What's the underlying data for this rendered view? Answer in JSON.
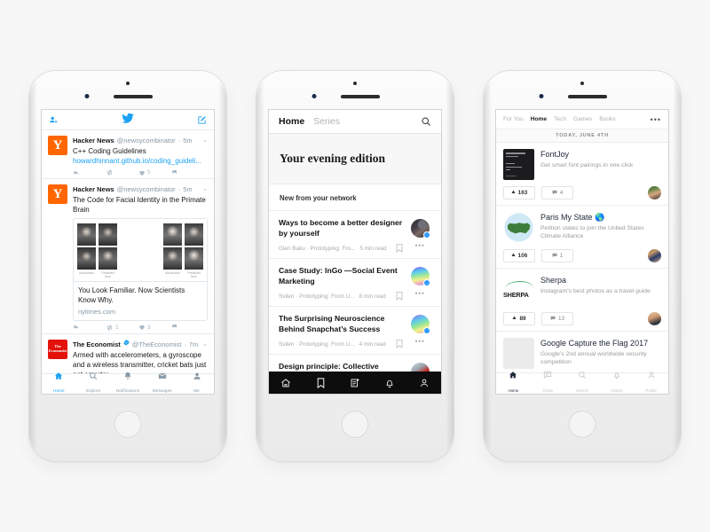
{
  "canvas": {
    "background": "#f7f7f7"
  },
  "phone1": {
    "app": "Twitter",
    "header": {
      "add_person_icon": "add-person-icon",
      "logo_icon": "twitter-bird-icon",
      "compose_icon": "compose-icon"
    },
    "tweets": [
      {
        "avatar_letter": "Y",
        "avatar_color": "#ff6600",
        "name": "Hacker News",
        "handle": "@newsycombinator",
        "time": "5m",
        "verified": false,
        "text": "C++ Coding Guidelines",
        "link": "howardhinnant.github.io/coding_guideli...",
        "replies": "",
        "retweets": "",
        "likes": "5",
        "card": null
      },
      {
        "avatar_letter": "Y",
        "avatar_color": "#ff6600",
        "name": "Hacker News",
        "handle": "@newsycombinator",
        "time": "5m",
        "verified": false,
        "text": "The Code for Facial Identity in the Primate Brain",
        "link": "",
        "replies": "",
        "retweets": "1",
        "likes": "3",
        "card": {
          "title": "You Look Familiar. Now Scientists Know Why.",
          "domain": "nytimes.com",
          "captions": [
            "Actual face",
            "Predicted face",
            "Actual face",
            "Predicted face"
          ]
        }
      },
      {
        "avatar_letter": "",
        "avatar_logo_text": "The Economist",
        "avatar_color": "#e3120b",
        "name": "The Economist",
        "handle": "@TheEconomist",
        "time": "7m",
        "verified": true,
        "text": "Armed with accelerometers, a gyroscope and a wireless transmitter, cricket bats just got smarter",
        "link": "",
        "card": null
      }
    ],
    "tabs": [
      {
        "label": "Home",
        "icon": "home-icon",
        "active": true
      },
      {
        "label": "Explore",
        "icon": "search-icon",
        "active": false
      },
      {
        "label": "Notifications",
        "icon": "bell-icon",
        "active": false
      },
      {
        "label": "Messages",
        "icon": "envelope-icon",
        "active": false
      },
      {
        "label": "Me",
        "icon": "person-icon",
        "active": false
      }
    ],
    "accent": "#1da1f2"
  },
  "phone2": {
    "app": "Medium",
    "header": {
      "tabs": [
        {
          "label": "Home",
          "active": true
        },
        {
          "label": "Series",
          "active": false
        }
      ],
      "search_icon": "search-icon"
    },
    "hero_title": "Your evening edition",
    "section_title": "New from your network",
    "articles": [
      {
        "title": "Ways to become a better designer by yourself",
        "byline": "Glen Baku · Prototyping: Fro...",
        "read_time": "5 min read",
        "bookmark_icon": "bookmark-icon",
        "more_icon": "ellipsis-icon"
      },
      {
        "title": "Case Study: InGo —Social Event Marketing",
        "byline": "Svilen · Prototyping: From U...",
        "read_time": "8 min read",
        "bookmark_icon": "bookmark-icon",
        "more_icon": "ellipsis-icon"
      },
      {
        "title": "The Surprising Neuroscience Behind Snapchat’s Success",
        "byline": "Svilen · Prototyping: From U...",
        "read_time": "4 min read",
        "bookmark_icon": "bookmark-icon",
        "more_icon": "ellipsis-icon"
      },
      {
        "title": "Design principle: Collective intelligence",
        "byline": "",
        "read_time": "",
        "bookmark_icon": "bookmark-icon",
        "more_icon": "ellipsis-icon"
      }
    ],
    "tabs": [
      {
        "icon": "home-icon",
        "active": true
      },
      {
        "icon": "bookmark-icon",
        "active": false
      },
      {
        "icon": "write-icon",
        "active": false
      },
      {
        "icon": "bell-icon",
        "active": false
      },
      {
        "icon": "person-icon",
        "active": false
      }
    ],
    "nav_background": "#0d0d0d"
  },
  "phone3": {
    "app": "Product Hunt",
    "header": {
      "tabs": [
        {
          "label": "For You",
          "active": false
        },
        {
          "label": "Home",
          "active": true
        },
        {
          "label": "Tech",
          "active": false
        },
        {
          "label": "Games",
          "active": false
        },
        {
          "label": "Books",
          "active": false
        }
      ],
      "more_icon": "ellipsis-icon"
    },
    "date_header": "TODAY, JUNE 4TH",
    "products": [
      {
        "name": "FontJoy",
        "tagline": "Get smart font pairings in one click",
        "upvotes": "163",
        "comments": "4",
        "upvote_icon": "triangle-up-icon",
        "comment_icon": "comment-icon"
      },
      {
        "name": "Paris My State 🌎",
        "tagline": "Petition states to join the United States Climate Alliance",
        "upvotes": "106",
        "comments": "1",
        "upvote_icon": "triangle-up-icon",
        "comment_icon": "comment-icon"
      },
      {
        "name": "Sherpa",
        "tagline": "Instagram’s best photos as a travel guide",
        "thumb_word": "SHERPA",
        "upvotes": "89",
        "comments": "13",
        "upvote_icon": "triangle-up-icon",
        "comment_icon": "comment-icon"
      },
      {
        "name": "Google Capture the Flag 2017",
        "tagline": "Google’s 2nd annual worldwide security competition",
        "upvotes": "",
        "comments": ""
      }
    ],
    "tabs": [
      {
        "label": "Home",
        "icon": "home-icon",
        "active": true
      },
      {
        "label": "Chats",
        "icon": "chat-icon",
        "active": false
      },
      {
        "label": "Search",
        "icon": "search-icon",
        "active": false
      },
      {
        "label": "Activity",
        "icon": "bell-icon",
        "active": false
      },
      {
        "label": "Profile",
        "icon": "person-icon",
        "active": false
      }
    ]
  }
}
